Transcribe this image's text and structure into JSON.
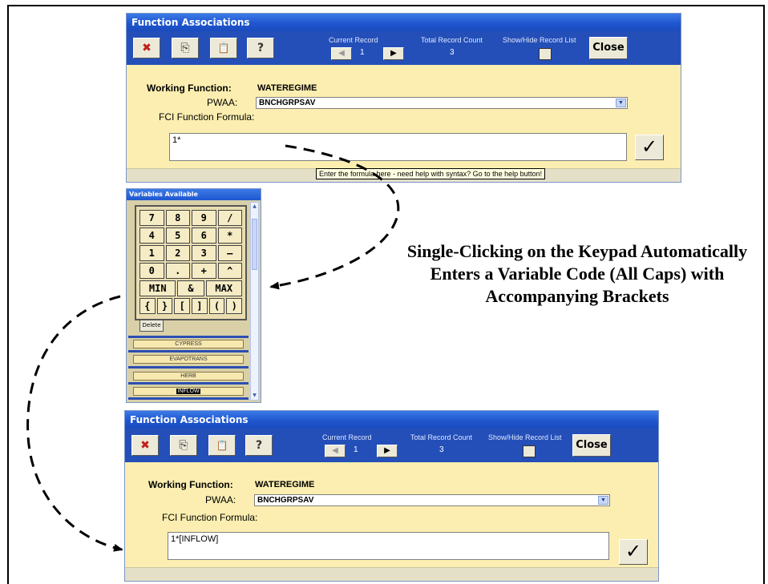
{
  "windows": [
    {
      "title": "Function Associations",
      "current_record_label": "Current Record",
      "current_record": "1",
      "total_count_label": "Total Record Count",
      "total_count": "3",
      "show_hide_label": "Show/Hide Record List",
      "close_label": "Close",
      "working_function_label": "Working Function:",
      "working_function_value": "WATEREGIME",
      "pwaa_label": "PWAA:",
      "pwaa_value": "BNCHGRPSAV",
      "formula_label": "FCI Function Formula:",
      "formula_value": "1*",
      "tooltip": "Enter the formula here - need help with syntax?  Go to the help button!",
      "ok_symbol": "✓"
    },
    {
      "title": "Function Associations",
      "current_record_label": "Current Record",
      "current_record": "1",
      "total_count_label": "Total Record Count",
      "total_count": "3",
      "show_hide_label": "Show/Hide Record List",
      "close_label": "Close",
      "working_function_label": "Working Function:",
      "working_function_value": "WATEREGIME",
      "pwaa_label": "PWAA:",
      "pwaa_value": "BNCHGRPSAV",
      "formula_label": "FCI Function Formula:",
      "formula_value": "1*[INFLOW]",
      "ok_symbol": "✓"
    }
  ],
  "toolbar_icons": [
    "delete-record-icon",
    "copy-icon",
    "paste-icon",
    "help-pointer-icon"
  ],
  "toolbar_glyphs": [
    "✖",
    "⎘",
    "📋",
    "?"
  ],
  "variables_panel": {
    "title": "Variables Available",
    "keypad": [
      [
        "7",
        "8",
        "9",
        "/"
      ],
      [
        "4",
        "5",
        "6",
        "*"
      ],
      [
        "1",
        "2",
        "3",
        "–"
      ],
      [
        "0",
        ".",
        "+",
        "^"
      ],
      [
        "MIN",
        "&",
        "MAX"
      ],
      [
        "{",
        "}",
        "[",
        "]",
        "(",
        ")"
      ]
    ],
    "delete_label": "Delete",
    "variables": [
      "CYPRESS",
      "EVAPOTRANS",
      "HERB",
      "INFLOW"
    ],
    "selected_variable": "INFLOW"
  },
  "caption": "Single-Clicking on the Keypad Automatically Enters a Variable Code (All Caps) with Accompanying Brackets",
  "colors": {
    "toolbar": "#244fb8",
    "form_background": "#fbeeb0",
    "titlebar": "#1f56cf"
  }
}
